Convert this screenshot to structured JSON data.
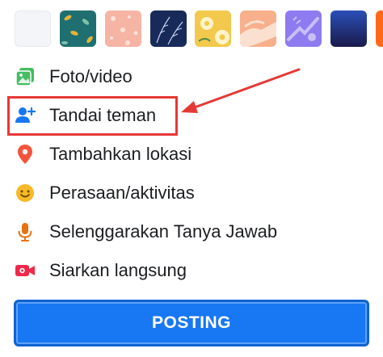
{
  "backgrounds": [
    {
      "name": "plain",
      "colors": [
        "#f3f5f9"
      ]
    },
    {
      "name": "teal-leaves",
      "colors": [
        "#1f6f71",
        "#e3b33b"
      ]
    },
    {
      "name": "pink-pattern",
      "colors": [
        "#f6b4a4",
        "#fce2d8"
      ]
    },
    {
      "name": "navy-botanical",
      "colors": [
        "#172a5a",
        "#c9d3f0"
      ]
    },
    {
      "name": "yellow-flowers",
      "colors": [
        "#f2c94c",
        "#fff4c9"
      ]
    },
    {
      "name": "peach-hands",
      "colors": [
        "#f7b08b",
        "#fbe0cf"
      ]
    },
    {
      "name": "purple-hands",
      "colors": [
        "#8f7bf0",
        "#c9bff8"
      ]
    },
    {
      "name": "blue-gradient",
      "colors": [
        "#2a4fb8",
        "#1a1a4a"
      ]
    },
    {
      "name": "orange-gradient",
      "colors": [
        "#ff7a1a",
        "#f0501a"
      ]
    }
  ],
  "menu": {
    "items": [
      {
        "label": "Foto/video",
        "icon": "photo-icon",
        "color": "#45bd62"
      },
      {
        "label": "Tandai teman",
        "icon": "tag-friend-icon",
        "color": "#1877f2"
      },
      {
        "label": "Tambahkan lokasi",
        "icon": "location-pin-icon",
        "color": "#f5533d"
      },
      {
        "label": "Perasaan/aktivitas",
        "icon": "smiley-icon",
        "color": "#f7b928"
      },
      {
        "label": "Selenggarakan Tanya Jawab",
        "icon": "microphone-icon",
        "color": "#e9710f"
      },
      {
        "label": "Siarkan langsung",
        "icon": "live-video-icon",
        "color": "#f02849"
      }
    ]
  },
  "annotation": {
    "color": "#e53935"
  },
  "post_button": {
    "label": "POSTING",
    "color": "#1877f2"
  }
}
